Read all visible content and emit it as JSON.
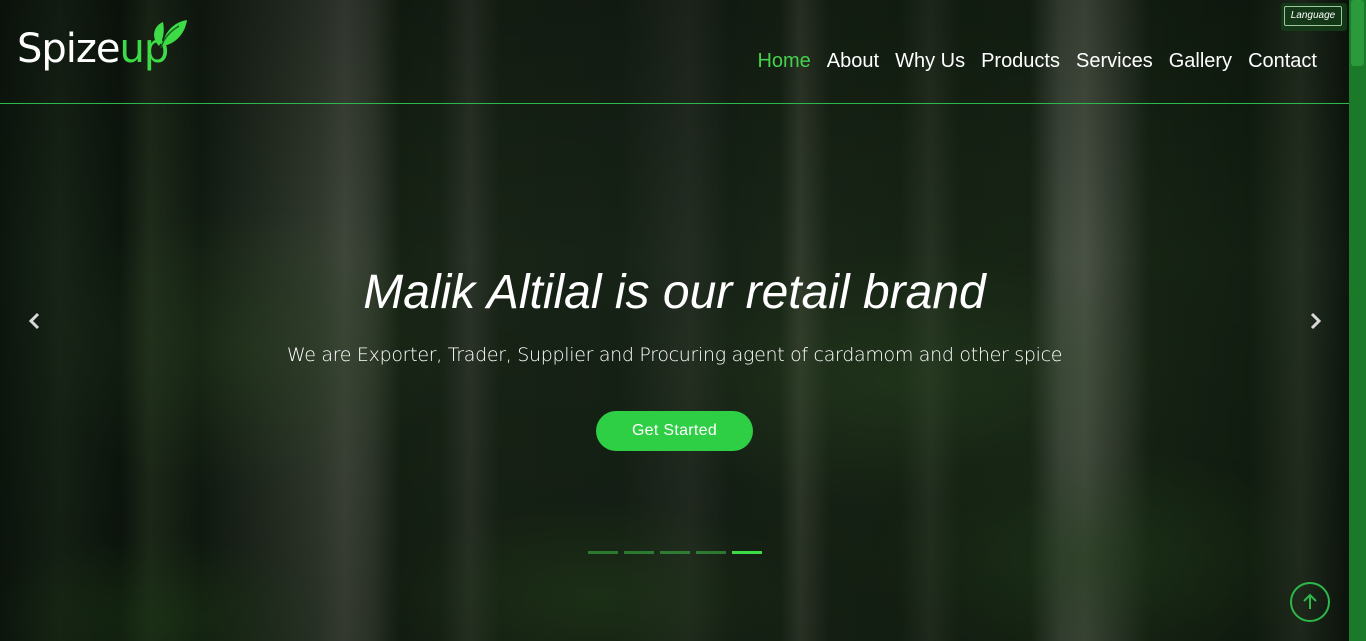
{
  "brand": {
    "logo_main": "Spize",
    "logo_accent": "up",
    "accent_color": "#3ddc47"
  },
  "language_button": {
    "label": "Language"
  },
  "nav": {
    "items": [
      {
        "label": "Home",
        "active": true
      },
      {
        "label": "About",
        "active": false
      },
      {
        "label": "Why Us",
        "active": false
      },
      {
        "label": "Products",
        "active": false
      },
      {
        "label": "Services",
        "active": false
      },
      {
        "label": "Gallery",
        "active": false
      },
      {
        "label": "Contact",
        "active": false
      }
    ]
  },
  "hero": {
    "title": "Malik Altilal is our retail brand",
    "subtitle": "We are Exporter, Trader, Supplier and Procuring agent of cardamom and other spice",
    "cta_label": "Get Started",
    "cta_color": "#2fcf45",
    "prev_icon": "chevron-left-icon",
    "next_icon": "chevron-right-icon",
    "slide_count": 5,
    "active_slide": 5
  },
  "back_to_top": {
    "icon": "arrow-up-icon"
  }
}
